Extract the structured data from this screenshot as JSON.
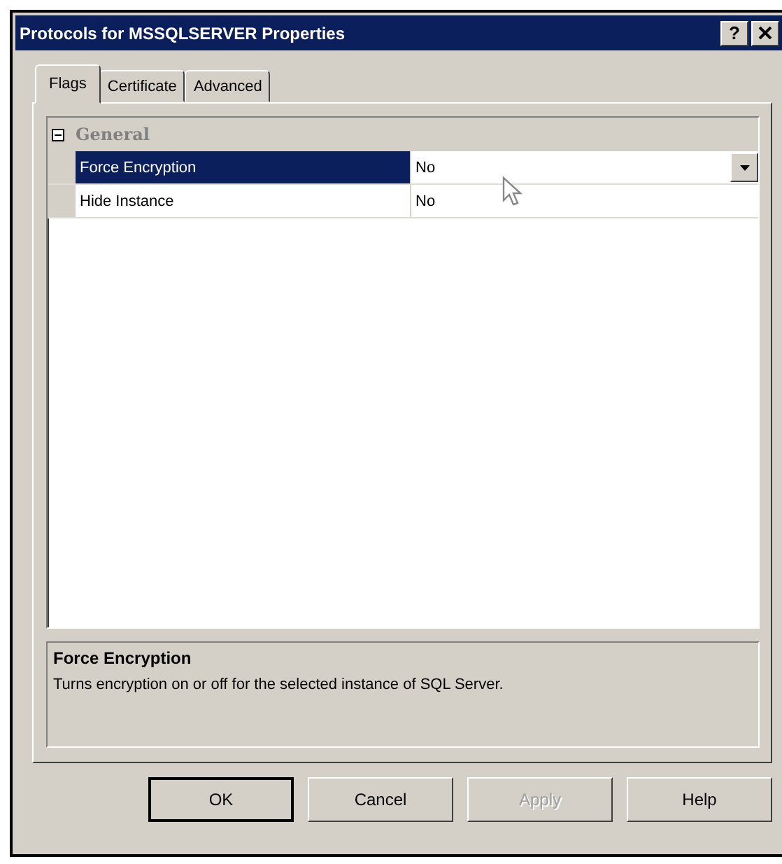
{
  "window": {
    "title": "Protocols for MSSQLSERVER Properties",
    "help_button": "?"
  },
  "tabs": [
    {
      "label": "Flags",
      "selected": true
    },
    {
      "label": "Certificate",
      "selected": false
    },
    {
      "label": "Advanced",
      "selected": false
    }
  ],
  "property_grid": {
    "categories": [
      {
        "name": "General",
        "expanded": true,
        "properties": [
          {
            "name": "Force Encryption",
            "value": "No",
            "selected": true
          },
          {
            "name": "Hide Instance",
            "value": "No",
            "selected": false
          }
        ]
      }
    ]
  },
  "description": {
    "title": "Force Encryption",
    "text": "Turns encryption on or off for the selected instance of SQL Server."
  },
  "buttons": [
    {
      "label": "OK",
      "disabled": false,
      "default": true
    },
    {
      "label": "Cancel",
      "disabled": false,
      "default": false
    },
    {
      "label": "Apply",
      "disabled": true,
      "default": false
    },
    {
      "label": "Help",
      "disabled": false,
      "default": false
    }
  ]
}
